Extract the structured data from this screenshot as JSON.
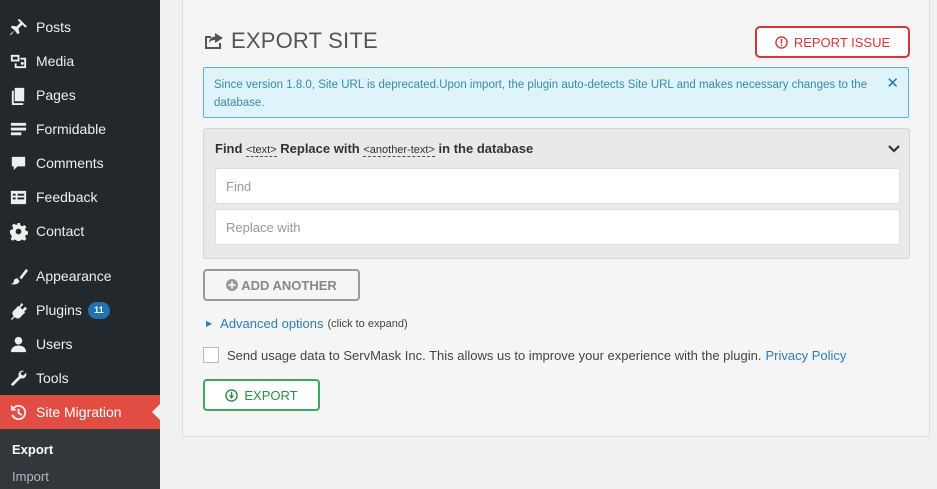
{
  "sidebar": {
    "items": [
      {
        "label": "Posts",
        "icon": "pin-icon"
      },
      {
        "label": "Media",
        "icon": "media-icon"
      },
      {
        "label": "Pages",
        "icon": "pages-icon"
      },
      {
        "label": "Formidable",
        "icon": "formidable-icon"
      },
      {
        "label": "Comments",
        "icon": "comment-icon"
      },
      {
        "label": "Feedback",
        "icon": "feedback-icon"
      },
      {
        "label": "Contact",
        "icon": "gear-icon"
      },
      {
        "label": "Appearance",
        "icon": "brush-icon"
      },
      {
        "label": "Plugins",
        "icon": "plugin-icon",
        "badge": "11"
      },
      {
        "label": "Users",
        "icon": "user-icon"
      },
      {
        "label": "Tools",
        "icon": "wrench-icon"
      },
      {
        "label": "Site Migration",
        "icon": "history-icon",
        "active": true
      }
    ],
    "submenu": {
      "export": "Export",
      "import": "Import"
    }
  },
  "main": {
    "title": "EXPORT SITE",
    "report_button": "REPORT ISSUE",
    "notice": "Since version 1.8.0, Site URL is deprecated.Upon import, the plugin auto-detects Site URL and makes necessary changes to the database.",
    "notice_close": "✕",
    "find_replace": {
      "find_label": "Find",
      "find_code": "<text>",
      "replace_label": "Replace with",
      "replace_code": "<another-text>",
      "suffix": "in the database",
      "find_placeholder": "Find",
      "replace_placeholder": "Replace with"
    },
    "add_another": "ADD ANOTHER",
    "advanced": {
      "link": "Advanced options",
      "hint": "(click to expand)"
    },
    "usage_text": "Send usage data to ServMask Inc. This allows us to improve your experience with the plugin.",
    "privacy_link": "Privacy Policy",
    "export_button": "EXPORT"
  },
  "colors": {
    "sidebar_bg": "#23282d",
    "active_item": "#e14d43",
    "link": "#2b7fb6",
    "report_red": "#d63638",
    "export_green": "#3da95a",
    "notice_bg": "#dff3fa"
  }
}
